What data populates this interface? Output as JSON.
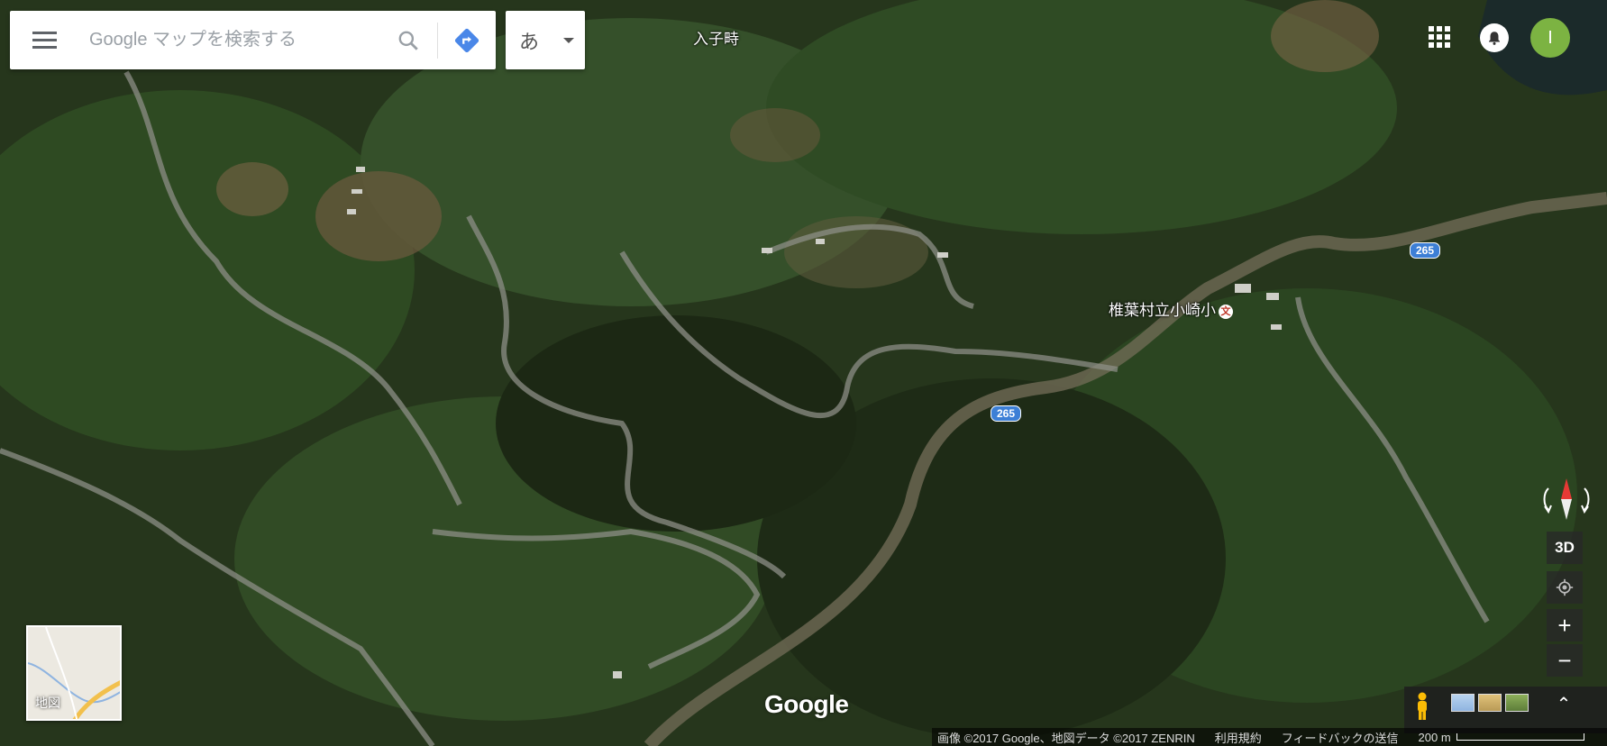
{
  "search": {
    "placeholder": "Google マップを検索する"
  },
  "ime": {
    "label": "あ"
  },
  "account": {
    "initial": "I"
  },
  "map_labels": {
    "village": "入子畤",
    "school": "椎葉村立小崎小",
    "school_marker": "文",
    "route_1": "265",
    "route_2": "265"
  },
  "controls": {
    "tilt": "3D",
    "zoom_in": "+",
    "zoom_out": "−",
    "expand": "⌃"
  },
  "layer": {
    "label": "地図"
  },
  "brand": "Google",
  "footer": {
    "imagery": "画像 ©2017 Google、地図データ ©2017 ZENRIN",
    "terms": "利用規約",
    "feedback": "フィードバックの送信",
    "scale": "200 m"
  },
  "colors": {
    "route_shield": "#3d7fd6",
    "avatar": "#7cb342",
    "directions": "#4a87e8"
  }
}
